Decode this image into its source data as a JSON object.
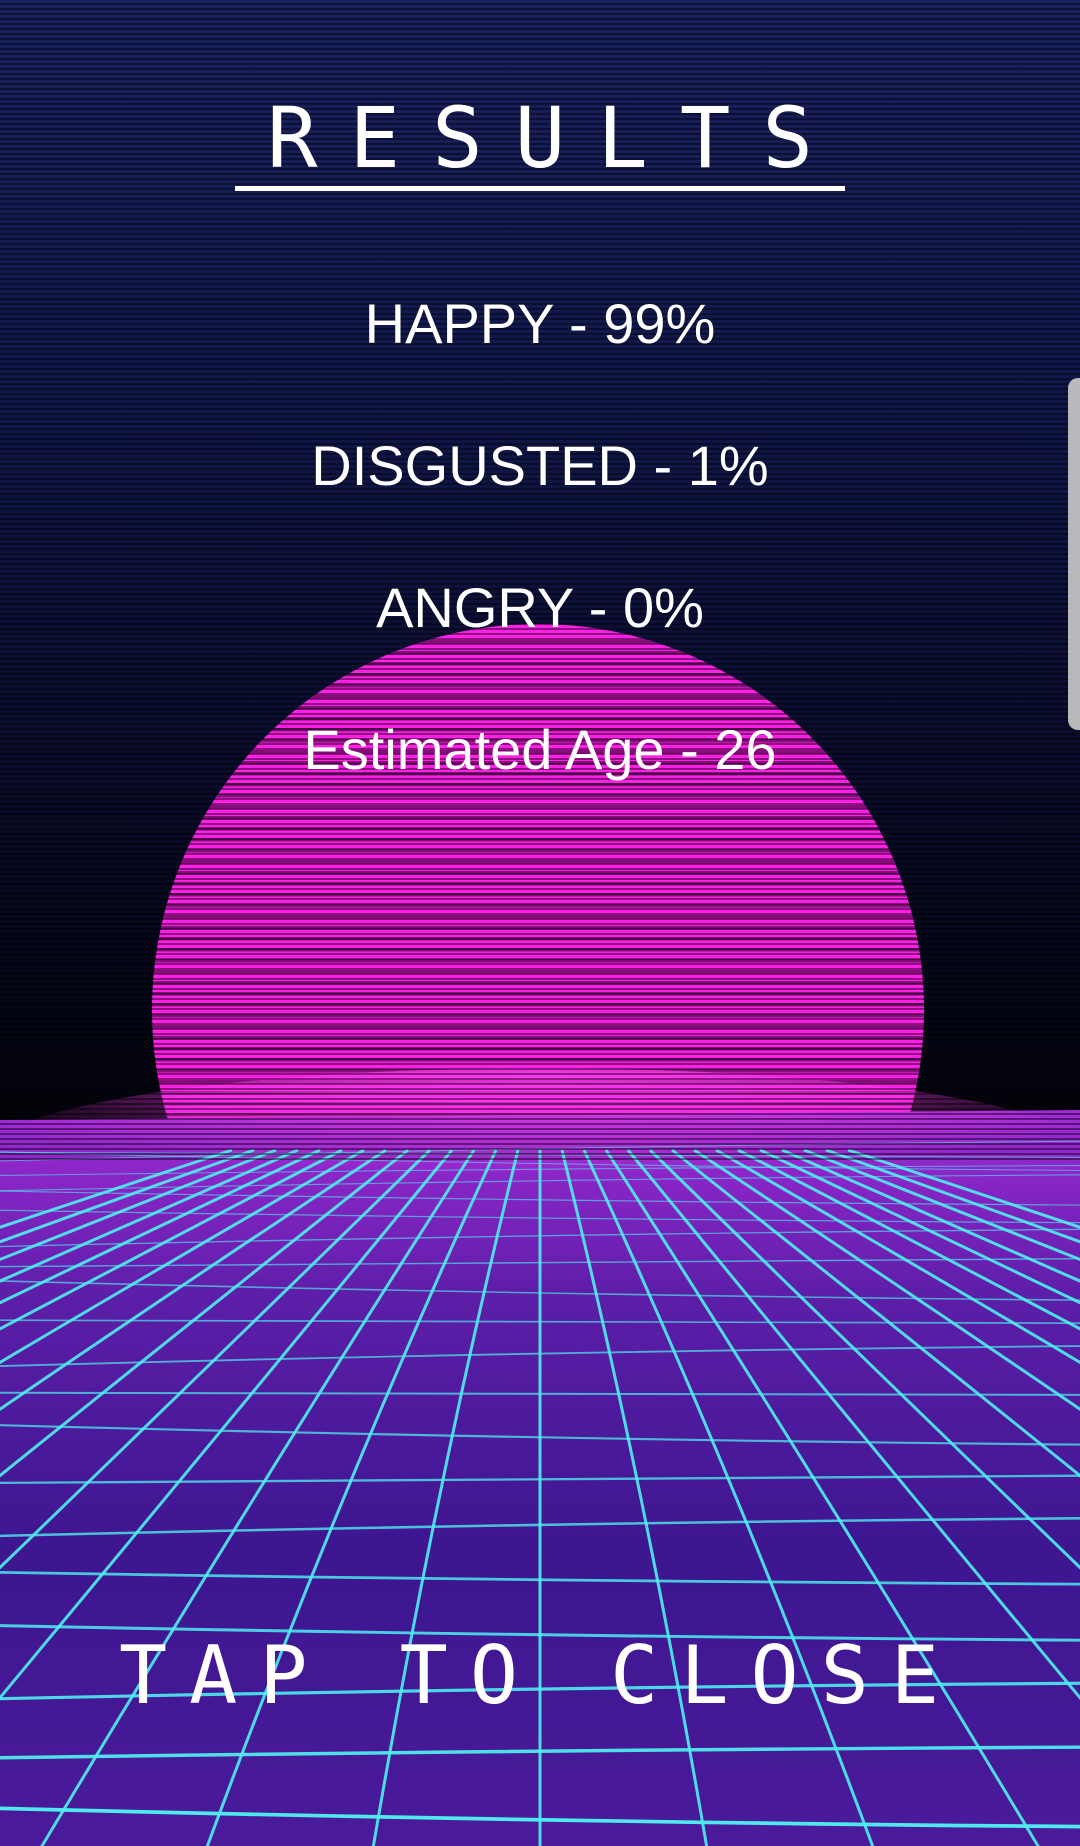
{
  "title": "RESULTS",
  "results": [
    {
      "label": "HAPPY - 99%"
    },
    {
      "label": "DISGUSTED - 1%"
    },
    {
      "label": "ANGRY - 0%"
    },
    {
      "label": "Estimated Age - 26"
    }
  ],
  "close_label": "TAP TO CLOSE",
  "colors": {
    "sun": "#ff1fe6",
    "grid_line": "#4ff0f0",
    "ground": "#3a1486",
    "sky_top": "#1a2160"
  }
}
